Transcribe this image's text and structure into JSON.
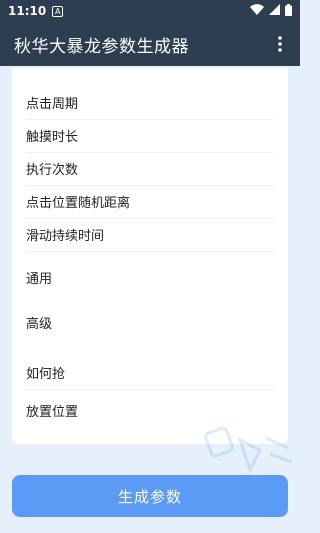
{
  "status_bar": {
    "time": "11:10",
    "notification_letter": "A"
  },
  "app_bar": {
    "title": "秋华大暴龙参数生成器"
  },
  "menu": {
    "items": [
      {
        "label": "点击周期"
      },
      {
        "label": "触摸时长"
      },
      {
        "label": "执行次数"
      },
      {
        "label": "点击位置随机距离"
      },
      {
        "label": "滑动持续时间"
      },
      {
        "label": "通用"
      },
      {
        "label": "高级"
      },
      {
        "label": "如何抢"
      },
      {
        "label": "放置位置"
      }
    ]
  },
  "primary_button": {
    "label": "生成参数"
  },
  "colors": {
    "header": "#2c3e50",
    "background": "#e6f0fb",
    "button": "#5b9bf5"
  }
}
